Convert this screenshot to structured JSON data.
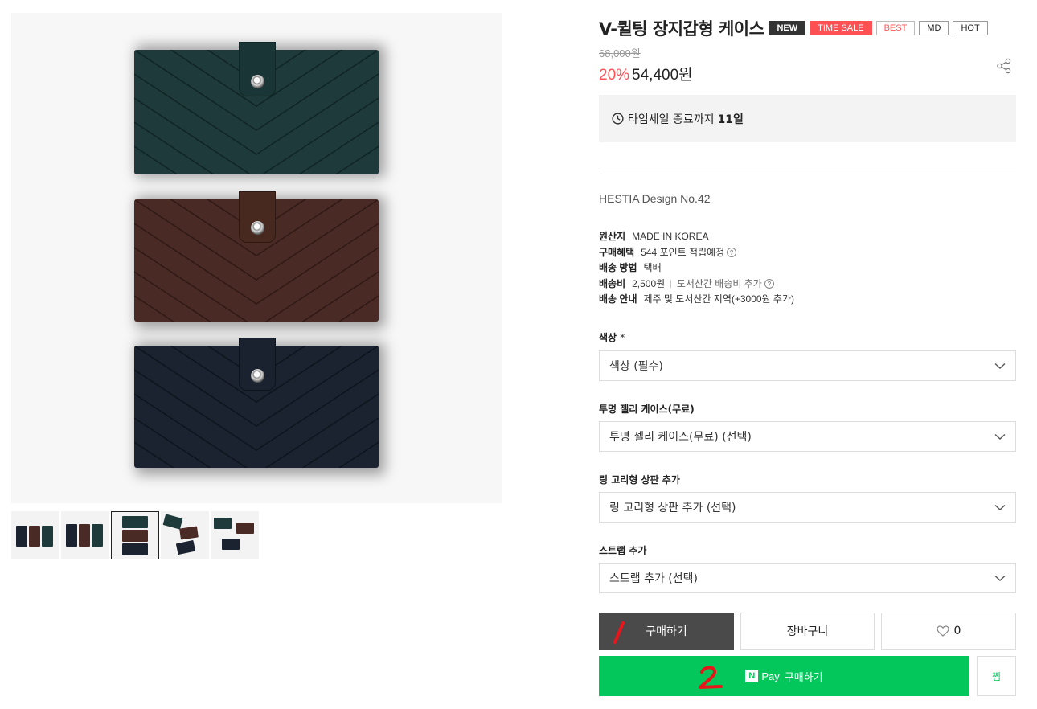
{
  "product": {
    "title": "V-퀼팅 장지갑형 케이스",
    "badges": [
      "NEW",
      "TIME SALE",
      "BEST",
      "MD",
      "HOT"
    ],
    "original_price": "68,000원",
    "discount_rate": "20%",
    "sale_price": "54,400원",
    "design": "HESTIA Design No.42"
  },
  "timesale": {
    "label": "타임세일 종료까지",
    "remaining": "11일"
  },
  "specs": [
    {
      "label": "원산지",
      "value": "MADE IN KOREA"
    },
    {
      "label": "구매혜택",
      "value": "544 포인트 적립예정"
    },
    {
      "label": "배송 방법",
      "value": "택배"
    },
    {
      "label": "배송비",
      "value": "2,500원",
      "extra": "도서산간 배송비 추가"
    },
    {
      "label": "배송 안내",
      "value": "제주 및 도서산간 지역(+3000원 추가)"
    }
  ],
  "options": [
    {
      "label": "색상",
      "required_mark": "*",
      "value": "색상 (필수)"
    },
    {
      "label": "투명 젤리 케이스(무료)",
      "value": "투명 젤리 케이스(무료) (선택)"
    },
    {
      "label": "링 고리형 상판 추가",
      "value": "링 고리형 상판 추가 (선택)"
    },
    {
      "label": "스트랩 추가",
      "value": "스트랩 추가 (선택)"
    }
  ],
  "actions": {
    "buy": "구매하기",
    "cart": "장바구니",
    "like_count": "0",
    "npay_n": "N",
    "npay_pay": "Pay",
    "npay_buy": "구매하기",
    "zzim": "찜"
  },
  "annotations": [
    "1",
    "2"
  ],
  "gallery": {
    "thumbnail_count": 5,
    "active_thumbnail": 3,
    "wallet_colors": [
      "#1e3a3a",
      "#4a2a24",
      "#1b2330"
    ]
  },
  "colors": {
    "accent_red": "#ff5054",
    "npay_green": "#03c75a",
    "buy_button": "#4a4a4a"
  }
}
